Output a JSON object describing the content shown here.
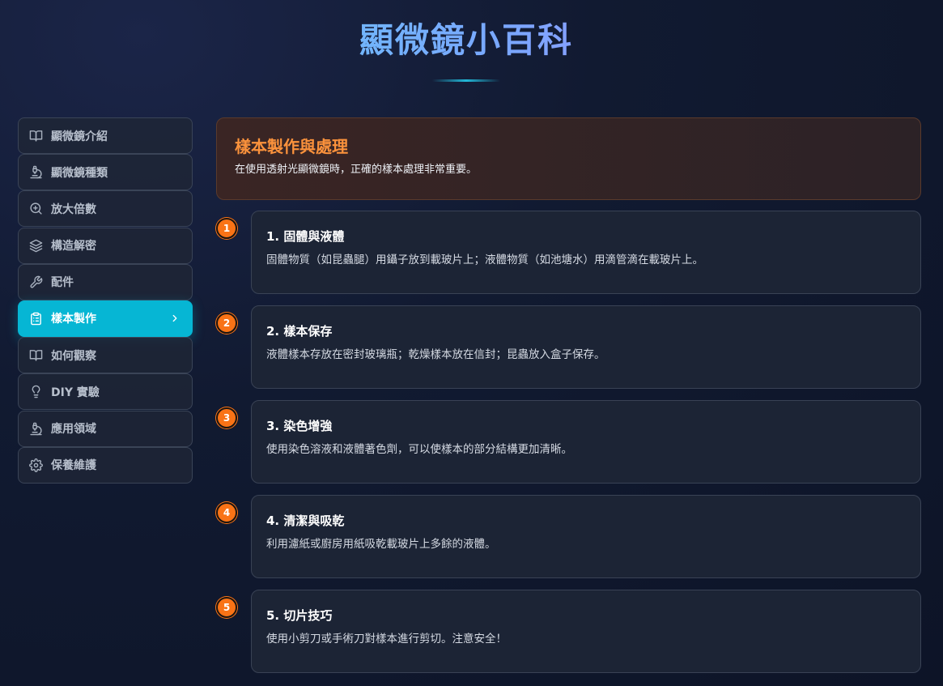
{
  "title": "顯微鏡小百科",
  "sidebar": {
    "items": [
      {
        "label": "顯微鏡介紹",
        "icon": "book-open-icon"
      },
      {
        "label": "顯微鏡種類",
        "icon": "microscope-icon"
      },
      {
        "label": "放大倍數",
        "icon": "zoom-in-icon"
      },
      {
        "label": "構造解密",
        "icon": "layers-icon"
      },
      {
        "label": "配件",
        "icon": "wrench-icon"
      },
      {
        "label": "樣本製作",
        "icon": "clipboard-icon",
        "active": true
      },
      {
        "label": "如何觀察",
        "icon": "book-open-icon"
      },
      {
        "label": "DIY 實驗",
        "icon": "lightbulb-icon"
      },
      {
        "label": "應用領域",
        "icon": "microscope-icon"
      },
      {
        "label": "保養維護",
        "icon": "gear-icon"
      }
    ]
  },
  "main": {
    "header": {
      "title": "樣本製作與處理",
      "description": "在使用透射光顯微鏡時，正確的樣本處理非常重要。"
    },
    "steps": [
      {
        "number": "1",
        "title": "1. 固體與液體",
        "description": "固體物質（如昆蟲腿）用鑷子放到載玻片上；液體物質（如池塘水）用滴管滴在載玻片上。"
      },
      {
        "number": "2",
        "title": "2. 樣本保存",
        "description": "液體樣本存放在密封玻璃瓶；乾燥樣本放在信封；昆蟲放入盒子保存。"
      },
      {
        "number": "3",
        "title": "3. 染色增強",
        "description": "使用染色溶液和液體著色劑，可以使樣本的部分結構更加清晰。"
      },
      {
        "number": "4",
        "title": "4. 清潔與吸乾",
        "description": "利用濾紙或廚房用紙吸乾載玻片上多餘的液體。"
      },
      {
        "number": "5",
        "title": "5. 切片技巧",
        "description": "使用小剪刀或手術刀對樣本進行剪切。注意安全！"
      }
    ]
  },
  "colors": {
    "accent": "#06b6d4",
    "orange": "#f97316",
    "header_title": "#fb923c"
  }
}
